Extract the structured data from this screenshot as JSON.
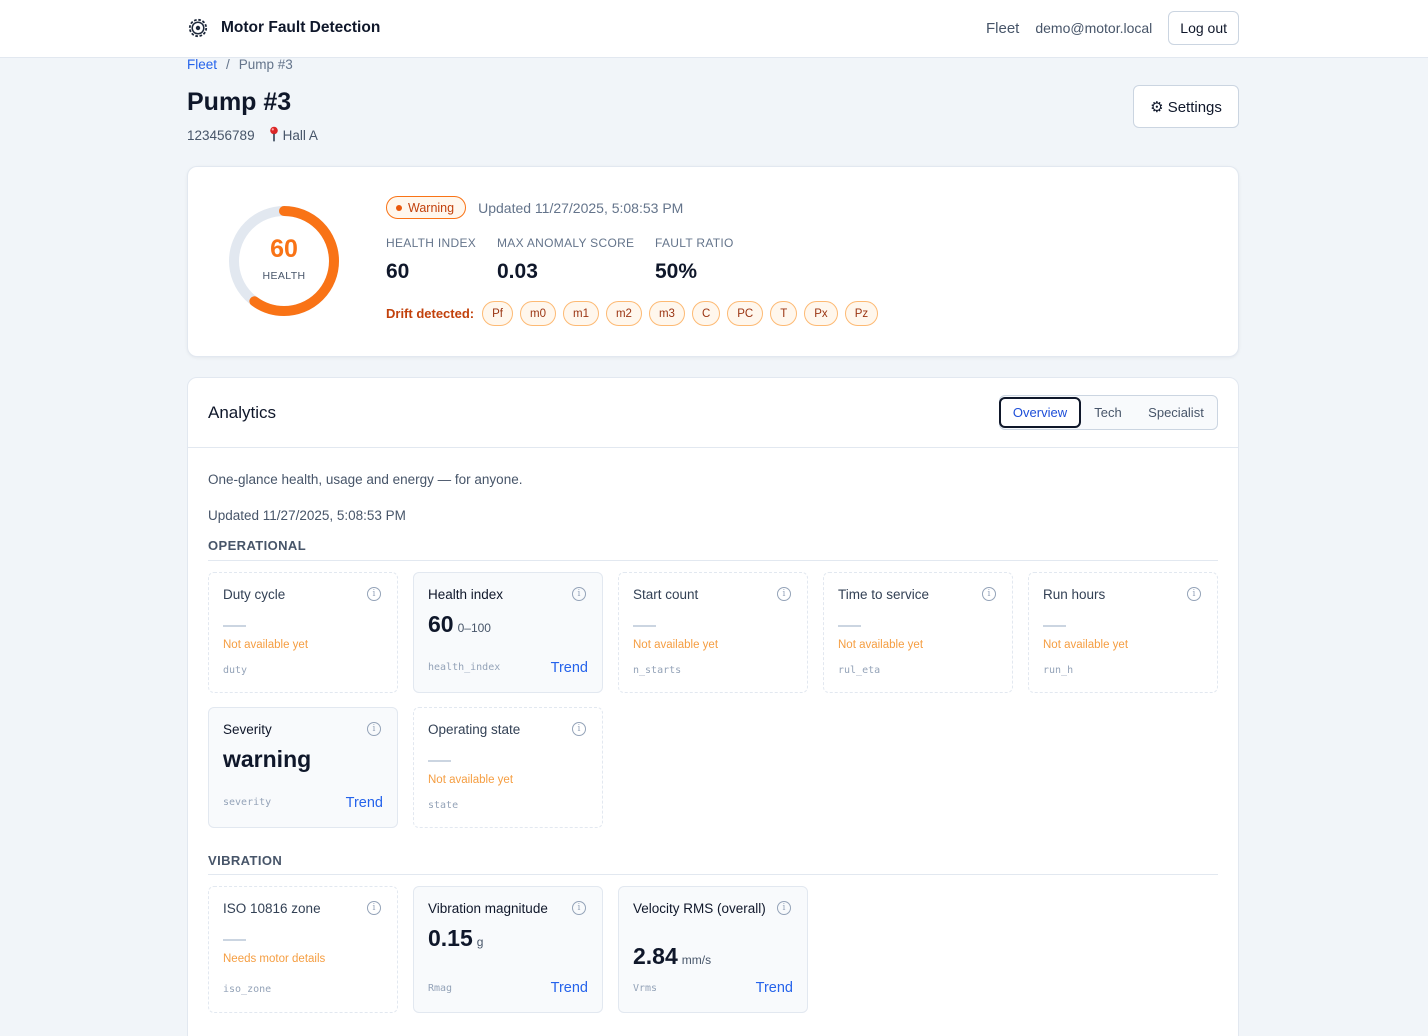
{
  "header": {
    "app_title": "Motor Fault Detection",
    "nav_fleet": "Fleet",
    "user_email": "demo@motor.local",
    "logout_label": "Log out"
  },
  "breadcrumb": {
    "root": "Fleet",
    "separator": "/",
    "current": "Pump #3"
  },
  "device": {
    "name": "Pump #3",
    "serial": "123456789",
    "location": "Hall A"
  },
  "settings_label": "⚙ Settings",
  "summary": {
    "health_score": 60,
    "gauge_value": "60",
    "gauge_label": "HEALTH",
    "status": "Warning",
    "status_color": "#f97316",
    "updated": "Updated 11/27/2025, 5:08:53 PM",
    "kpis": [
      {
        "label": "HEALTH INDEX",
        "value": "60"
      },
      {
        "label": "MAX ANOMALY SCORE",
        "value": "0.03"
      },
      {
        "label": "FAULT RATIO",
        "value": "50%"
      }
    ],
    "drift_label": "Drift detected:",
    "drift_chips": [
      "Pf",
      "m0",
      "m1",
      "m2",
      "m3",
      "C",
      "PC",
      "T",
      "Px",
      "Pz"
    ]
  },
  "analytics": {
    "title": "Analytics",
    "tabs": [
      "Overview",
      "Tech",
      "Specialist"
    ],
    "active_tab": "Overview",
    "intro": "One-glance health, usage and energy — for anyone.",
    "updated": "Updated 11/27/2025, 5:08:53 PM",
    "operational_title": "OPERATIONAL",
    "vibration_title": "VIBRATION",
    "operational": [
      {
        "title": "Duty cycle",
        "na": "Not available yet",
        "key": "duty"
      },
      {
        "title": "Health index",
        "value": "60",
        "unit": "0–100",
        "key": "health_index",
        "trend": "Trend"
      },
      {
        "title": "Start count",
        "na": "Not available yet",
        "key": "n_starts"
      },
      {
        "title": "Time to service",
        "na": "Not available yet",
        "key": "rul_eta"
      },
      {
        "title": "Run hours",
        "na": "Not available yet",
        "key": "run_h"
      },
      {
        "title": "Severity",
        "value": "warning",
        "key": "severity",
        "trend": "Trend"
      },
      {
        "title": "Operating state",
        "na": "Not available yet",
        "key": "state"
      }
    ],
    "vibration": [
      {
        "title": "ISO 10816 zone",
        "na": "Needs motor details",
        "key": "iso_zone"
      },
      {
        "title": "Vibration magnitude",
        "value": "0.15",
        "unit": "g",
        "key": "Rmag",
        "trend": "Trend"
      },
      {
        "title": "Velocity RMS (overall)",
        "value": "2.84",
        "unit": "mm/s",
        "key": "Vrms",
        "trend": "Trend"
      }
    ],
    "info_icon": "i"
  }
}
